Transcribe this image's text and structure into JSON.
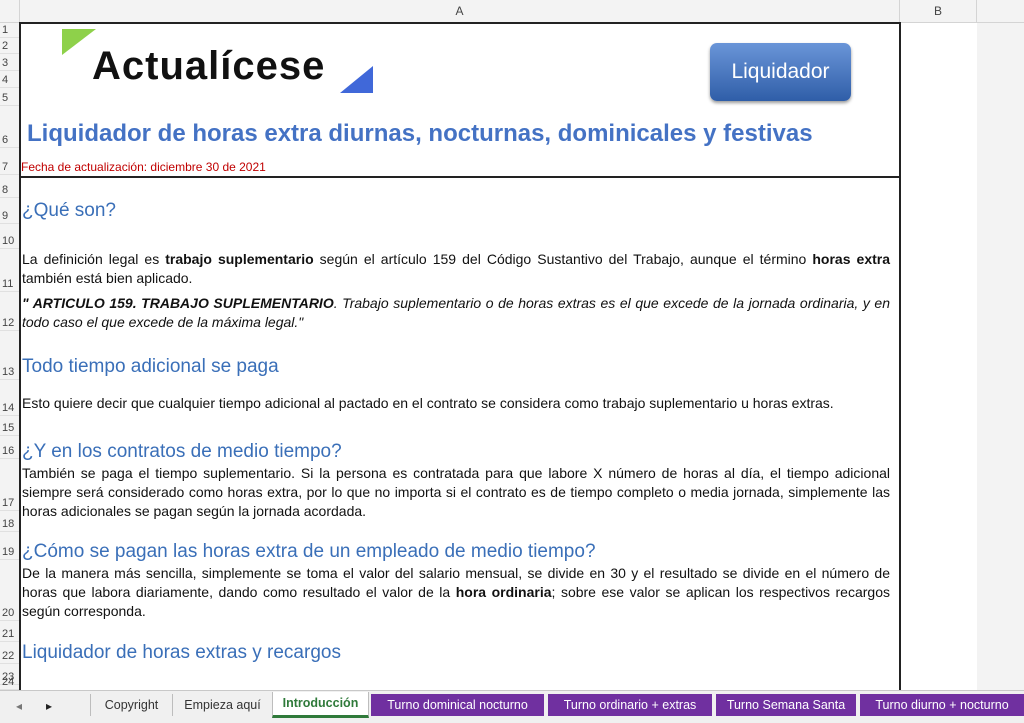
{
  "spreadsheet": {
    "columns": [
      "A",
      "B"
    ],
    "rows": [
      "1",
      "2",
      "3",
      "4",
      "5",
      "6",
      "7",
      "8",
      "9",
      "10",
      "11",
      "12",
      "13",
      "14",
      "15",
      "16",
      "17",
      "18",
      "19",
      "20",
      "21",
      "22",
      "23",
      "24"
    ]
  },
  "header": {
    "logo_text": "Actualícese",
    "button_label": "Liquidador",
    "title": "Liquidador de horas extra diurnas, nocturnas, dominicales y festivas",
    "updated": "Fecha de actualización: diciembre 30 de 2021"
  },
  "content": {
    "h_que_son": "¿Qué son?",
    "p1_a": "La definición legal es ",
    "p1_b": "trabajo suplementario",
    "p1_c": " según el artículo 159 del Código Sustantivo del Trabajo, aunque el término ",
    "p1_d": "horas extra",
    "p1_e": " también está bien aplicado.",
    "q_a": "\" ARTICULO 159. TRABAJO SUPLEMENTARIO",
    "q_b": ". Trabajo suplementario o de horas extras es el que excede de la jornada ordinaria, y en todo caso el que excede de la máxima legal.\"",
    "h_todo": "Todo tiempo adicional se paga",
    "p2": "Esto quiere decir que cualquier tiempo adicional al pactado en el contrato se considera como trabajo suplementario u horas extras.",
    "h_medio": "¿Y en los contratos de medio tiempo?",
    "p3": "También se paga el tiempo suplementario. Si la persona es contratada para que labore X número de horas al día, el tiempo adicional siempre será considerado como horas extra, por lo que no importa si el contrato es de tiempo completo o media jornada, simplemente las horas adicionales se pagan según la jornada acordada.",
    "h_como": "¿Cómo se pagan las horas extra de un empleado de medio tiempo?",
    "p4_a": "De la manera más sencilla, simplemente se toma el valor del salario mensual, se divide en 30 y el resultado se divide en el número de horas que labora diariamente, dando como resultado el valor de la ",
    "p4_b": "hora ordinaria",
    "p4_c": "; sobre ese valor se aplican los respectivos recargos según corresponda.",
    "h_liq": "Liquidador de horas extras y recargos"
  },
  "tabs": {
    "nav_prev": "◂",
    "nav_next": "▸",
    "items": [
      "Copyright",
      "Empieza aquí",
      "Introducción",
      "Turno dominical nocturno",
      "Turno ordinario + extras",
      "Turno Semana Santa",
      "Turno diurno + nocturno"
    ],
    "active": "Introducción",
    "purple": "#7030a0"
  }
}
